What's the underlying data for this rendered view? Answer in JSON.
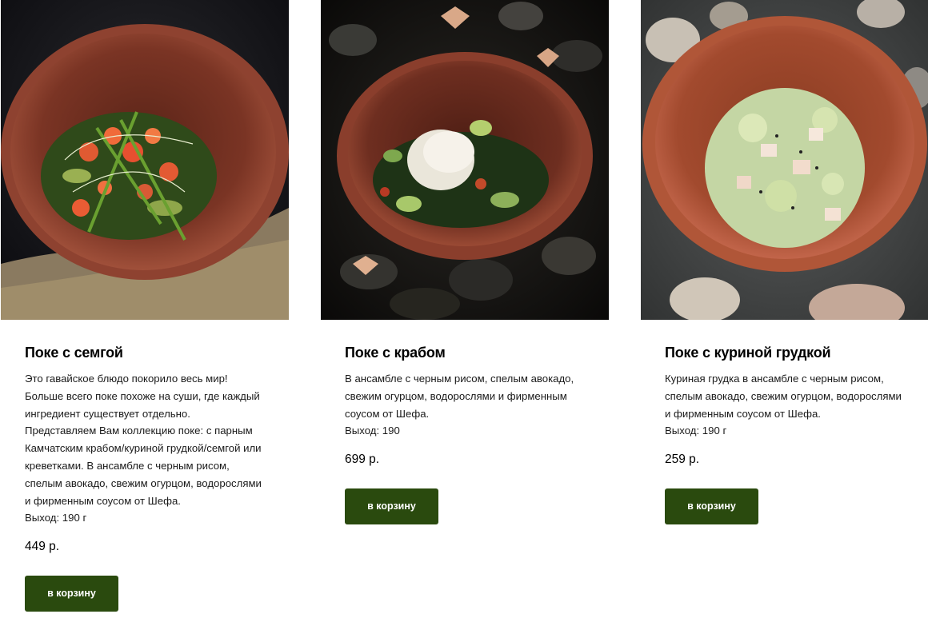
{
  "products": [
    {
      "title": "Поке с семгой",
      "description": "Это гавайское блюдо покорило весь мир!\nБольше всего поке похоже на суши, где каждый ингредиент существует отдельно.\nПредставляем Вам коллекцию поке: с парным Камчатским крабом/куриной грудкой/семгой или креветками. В ансамбле с черным рисом, спелым авокадо, свежим огурцом, водорослями и фирменным соусом от Шефа.\nВыход: 190 г",
      "price": "449 р.",
      "button_label": "в корзину",
      "image": "poke-salmon-photo"
    },
    {
      "title": "Поке с крабом",
      "description": "В ансамбле с черным рисом, спелым авокадо, свежим огурцом, водорослями и фирменным соусом от Шефа.\nВыход: 190",
      "price": "699 р.",
      "button_label": "в корзину",
      "image": "poke-crab-photo"
    },
    {
      "title": "Поке с куриной грудкой",
      "description": "Куриная грудка в ансамбле с черным рисом, спелым авокадо, свежим огурцом, водорослями и фирменным соусом от Шефа.\nВыход: 190 г",
      "price": "259 р.",
      "button_label": "в корзину",
      "image": "poke-chicken-photo"
    }
  ],
  "colors": {
    "button_bg": "#2a4a0e",
    "button_text": "#ffffff",
    "text": "#111111"
  }
}
